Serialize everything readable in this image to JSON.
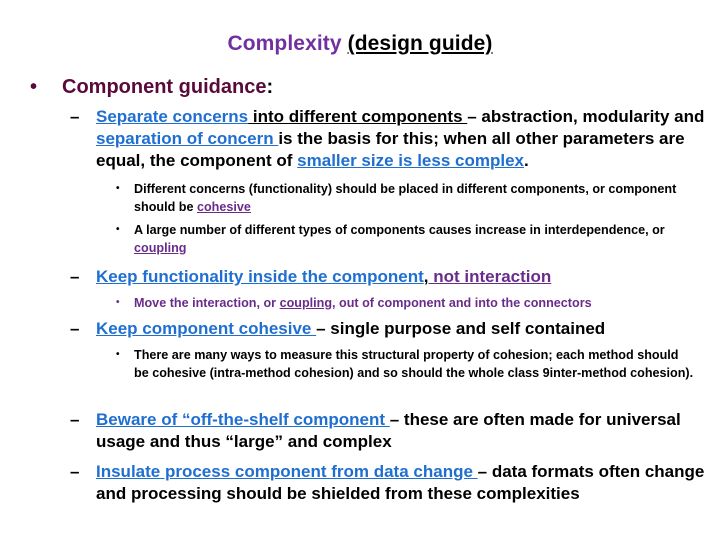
{
  "title": {
    "main": "Complexity",
    "sub": "(design guide)"
  },
  "colors": {
    "title_purple": "#7030a0",
    "maroon": "#5a0a3a",
    "link_blue": "#1f6fd1",
    "purple": "#6a2c8a"
  },
  "level1": {
    "bullet": "•",
    "label": "Component guidance",
    "colon": ":"
  },
  "items": [
    {
      "dash": "–",
      "p1": "Separate concerns",
      "p2": " into different components ",
      "p3": "– abstraction, modularity and ",
      "p4": "separation of concern ",
      "p5": "is the basis for this; when all other parameters are equal, the component of ",
      "p6": "smaller size is less complex",
      "p7": ".",
      "subs": [
        {
          "dot": "•",
          "text": "Different concerns (functionality) should be placed in different components, or component should be ",
          "link": "cohesive"
        },
        {
          "dot": "•",
          "text": "A large number of different types of components causes increase in interdependence, or ",
          "link": "coupling"
        }
      ]
    },
    {
      "dash": "–",
      "p1": "Keep functionality inside the component",
      "p2": ",",
      "p3": " not interaction",
      "subs": [
        {
          "dot": "•",
          "t1": "Move the interaction, or ",
          "link": "coupling,",
          "t2": " out of component and into the connectors"
        }
      ]
    },
    {
      "dash": "–",
      "p1": "Keep component cohesive ",
      "p2": "– single purpose and self contained",
      "subs": [
        {
          "dot": "•",
          "text": "There are many ways to measure this structural property of cohesion; each method should be cohesive (intra-method cohesion) and so should the whole class 9inter-method cohesion)."
        }
      ]
    },
    {
      "dash": "–",
      "p1": "Beware of “off-the-shelf component ",
      "p2": "– these are often made for universal usage and thus “large” and complex"
    },
    {
      "dash": "–",
      "p1": "Insulate process component from data change ",
      "p2": "– data formats often change and processing should be shielded from these complexities"
    }
  ]
}
